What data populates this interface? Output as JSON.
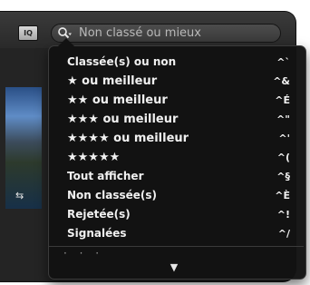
{
  "toolbar": {
    "iq_label": "IQ",
    "search": {
      "placeholder": "Non classé ou mieux",
      "value": ""
    }
  },
  "menu": {
    "items": [
      {
        "label": "Classée(s) ou non",
        "shortcut": "^`"
      },
      {
        "label": "★ ou meilleur",
        "shortcut": "^&"
      },
      {
        "label": "★★ ou meilleur",
        "shortcut": "^É"
      },
      {
        "label": "★★★ ou meilleur",
        "shortcut": "^\""
      },
      {
        "label": "★★★★ ou meilleur",
        "shortcut": "^'"
      },
      {
        "label": "★★★★★",
        "shortcut": "^("
      },
      {
        "label": "Tout afficher",
        "shortcut": "^§"
      },
      {
        "label": "Non classée(s)",
        "shortcut": "^È"
      },
      {
        "label": "Rejetée(s)",
        "shortcut": "^!"
      },
      {
        "label": "Signalées",
        "shortcut": "^/"
      }
    ],
    "more_dots": "· · ·",
    "scroll_down": "▼"
  },
  "thumbnail": {
    "badge": "⇆"
  },
  "icons": {
    "search": "magnifier-icon",
    "dropdown": "chevron-down-icon"
  }
}
